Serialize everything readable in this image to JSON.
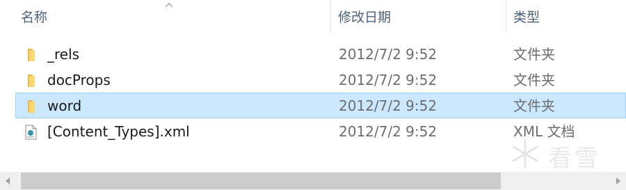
{
  "columns": {
    "name": "名称",
    "modified": "修改日期",
    "type": "类型"
  },
  "files": [
    {
      "name": "_rels",
      "modified": "2012/7/2 9:52",
      "type": "文件夹",
      "icon": "folder-icon"
    },
    {
      "name": "docProps",
      "modified": "2012/7/2 9:52",
      "type": "文件夹",
      "icon": "folder-icon"
    },
    {
      "name": "word",
      "modified": "2012/7/2 9:52",
      "type": "文件夹",
      "icon": "folder-icon",
      "selected": true
    },
    {
      "name": "[Content_Types].xml",
      "modified": "2012/7/2 9:52",
      "type": "XML 文档",
      "icon": "xml-file-icon"
    }
  ],
  "watermark": {
    "text": "看雪"
  },
  "colors": {
    "selection_bg": "#cce8ff",
    "selection_border": "#99d1ff",
    "header_text": "#4c607a",
    "folder": "#f8d775"
  }
}
